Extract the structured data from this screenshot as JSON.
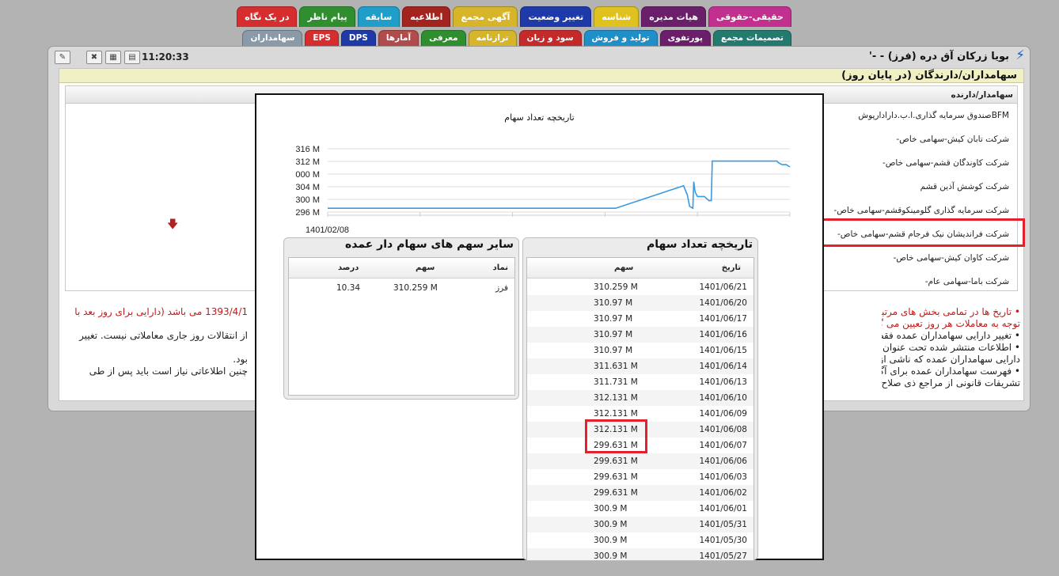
{
  "tabs_row1": [
    {
      "label": "در یک نگاه",
      "bg": "#d62e2e",
      "fg": "#ffffff"
    },
    {
      "label": "پیام ناظر",
      "bg": "#2f8f2f",
      "fg": "#ffffff"
    },
    {
      "label": "سابقه",
      "bg": "#1f9ec9",
      "fg": "#ffffff"
    },
    {
      "label": "اطلاعیه",
      "bg": "#a3231f",
      "fg": "#ffffff"
    },
    {
      "label": "آگهی مجمع",
      "bg": "#d6b52a",
      "fg": "#ffffff"
    },
    {
      "label": "تغییر وضعیت",
      "bg": "#1e3aa8",
      "fg": "#ffffff"
    },
    {
      "label": "شناسه",
      "bg": "#e0c21f",
      "fg": "#ffffff"
    },
    {
      "label": "هیات مدیره",
      "bg": "#6b1f6b",
      "fg": "#ffffff"
    },
    {
      "label": "حقیقی-حقوقی",
      "bg": "#c2308f",
      "fg": "#ffffff"
    }
  ],
  "tabs_row2": [
    {
      "label": "سهامداران",
      "bg": "#8a9aa8",
      "fg": "#ffffff"
    },
    {
      "label": "EPS",
      "bg": "#d62e2e",
      "fg": "#ffffff"
    },
    {
      "label": "DPS",
      "bg": "#1f3aa8",
      "fg": "#ffffff"
    },
    {
      "label": "آمارها",
      "bg": "#b24b4b",
      "fg": "#ffffff"
    },
    {
      "label": "معرفی",
      "bg": "#2f8f2f",
      "fg": "#ffffff"
    },
    {
      "label": "ترازنامه",
      "bg": "#d6b52a",
      "fg": "#ffffff"
    },
    {
      "label": "سود و زیان",
      "bg": "#c42a2a",
      "fg": "#ffffff"
    },
    {
      "label": "تولید و فروش",
      "bg": "#1f8fc9",
      "fg": "#ffffff"
    },
    {
      "label": "پورتفوی",
      "bg": "#6b1f6b",
      "fg": "#ffffff"
    },
    {
      "label": "تصمیمات مجمع",
      "bg": "#237a6e",
      "fg": "#ffffff"
    }
  ],
  "header": {
    "stock_title": "بویا زرکان آق دره (فرز) - -'",
    "clock": "11:20:33"
  },
  "section_title": "سهامداران/دارندگان (در پایان روز)",
  "shareholders": {
    "column_label": "سهامدار/دارنده",
    "rows": [
      "BFMصندوق سرمایه گذاری.ا.ب.دارادارپوش",
      "شرکت تابان کیش-سهامی خاص-",
      "شرکت کاوندگان قشم-سهامی خاص-",
      "شرکت کوشش آذین قشم",
      "شرکت سرمایه گذاری گلومینکوقشم-سهامی خاص-",
      "شرکت فراندیشان نیک فرجام قشم-سهامی خاص-",
      "شرکت کاوان کیش-سهامی خاص-",
      "شرکت باما-سهامی عام-"
    ]
  },
  "notes": [
    {
      "text": "• تاریخ ها در تمامی بخش های مرتبط با",
      "red": true
    },
    {
      "text": "توجه به معاملات هر روز تعیین می گردد",
      "red": true
    },
    {
      "text": "• تغییر دارایی سهامداران عمده فقط ناشی",
      "red": false
    },
    {
      "text": "• اطلاعات منتشر شده تحت عنوان دارایی",
      "red": false
    },
    {
      "text": "دارایی سهامداران عمده که ناشی از نق",
      "red": false
    },
    {
      "text": "• فهرست سهامداران عمده برای آگاهی و",
      "red": false
    },
    {
      "text": "تشریفات قانونی از مراجع ذی صلاح (شـ",
      "red": false
    }
  ],
  "notes_left": [
    {
      "text": "1393/4/1 می باشد (دارایی برای روز بعد با",
      "red": true
    },
    {
      "text": "از انتقالات روز جاری معاملاتی نیست. تغییر",
      "red": false
    },
    {
      "text": "بود.",
      "red": false
    },
    {
      "text": "چنین اطلاعاتی نیاز است باید پس از طی",
      "red": false
    }
  ],
  "chart_data": {
    "type": "line",
    "title": "تاریخچه تعداد سهام",
    "xlabel": "",
    "ylabel": "",
    "x_first_label": "1401/02/08",
    "y_tick_labels": [
      "316 M",
      "312 M",
      "000 M",
      "304 M",
      "300 M",
      "296 M"
    ],
    "ylim": [
      296,
      316
    ],
    "grid": true,
    "line_color": "#3a9ae0",
    "series": [
      {
        "values": [
          [
            0,
            297.2
          ],
          [
            0.623,
            297.2
          ],
          [
            0.77,
            304.3
          ],
          [
            0.778,
            301.4
          ],
          [
            0.783,
            297.8
          ],
          [
            0.79,
            297.2
          ],
          [
            0.792,
            305.6
          ],
          [
            0.795,
            302.3
          ],
          [
            0.8,
            300.9
          ],
          [
            0.815,
            300.9
          ],
          [
            0.825,
            299.6
          ],
          [
            0.83,
            299.6
          ],
          [
            0.832,
            312.1
          ],
          [
            0.86,
            312.1
          ],
          [
            0.95,
            312.1
          ],
          [
            0.972,
            312.1
          ],
          [
            0.975,
            311.6
          ],
          [
            0.983,
            310.97
          ],
          [
            0.992,
            310.97
          ],
          [
            1.0,
            310.26
          ]
        ]
      }
    ]
  },
  "history_box": {
    "title": "تاریخچه تعداد سهام",
    "col_date": "تاریخ",
    "col_shares": "سهم",
    "rows": [
      {
        "date": "1401/06/21",
        "shares": "310.259 M"
      },
      {
        "date": "1401/06/20",
        "shares": "310.97 M"
      },
      {
        "date": "1401/06/17",
        "shares": "310.97 M"
      },
      {
        "date": "1401/06/16",
        "shares": "310.97 M"
      },
      {
        "date": "1401/06/15",
        "shares": "310.97 M"
      },
      {
        "date": "1401/06/14",
        "shares": "311.631 M"
      },
      {
        "date": "1401/06/13",
        "shares": "311.731 M"
      },
      {
        "date": "1401/06/10",
        "shares": "312.131 M"
      },
      {
        "date": "1401/06/09",
        "shares": "312.131 M"
      },
      {
        "date": "1401/06/08",
        "shares": "312.131 M"
      },
      {
        "date": "1401/06/07",
        "shares": "299.631 M"
      },
      {
        "date": "1401/06/06",
        "shares": "299.631 M"
      },
      {
        "date": "1401/06/03",
        "shares": "299.631 M"
      },
      {
        "date": "1401/06/02",
        "shares": "299.631 M"
      },
      {
        "date": "1401/06/01",
        "shares": "300.9 M"
      },
      {
        "date": "1401/05/31",
        "shares": "300.9 M"
      },
      {
        "date": "1401/05/30",
        "shares": "300.9 M"
      },
      {
        "date": "1401/05/27",
        "shares": "300.9 M"
      }
    ]
  },
  "other_box": {
    "title": "سایر سهم های سهام دار عمده",
    "col_symbol": "نماد",
    "col_shares": "سهم",
    "col_percent": "درصد",
    "rows": [
      {
        "symbol": "فرز",
        "shares": "310.259 M",
        "percent": "10.34"
      }
    ]
  }
}
